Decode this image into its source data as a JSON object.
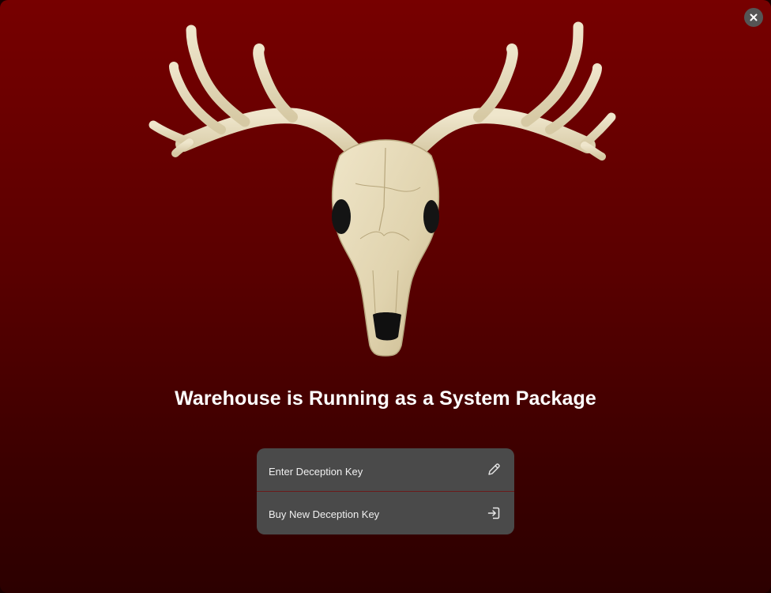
{
  "window": {
    "close_icon": "close-icon"
  },
  "hero": {
    "image": "deer-skull-antlers"
  },
  "title": "Warehouse is Running as a System Package",
  "menu": {
    "items": [
      {
        "label": "Enter Deception Key",
        "icon": "pencil-icon"
      },
      {
        "label": "Buy New Deception Key",
        "icon": "sign-in-icon"
      }
    ]
  },
  "colors": {
    "background_top": "#770000",
    "background_bottom": "#2c0000",
    "menu_bg": "#4a4a4a",
    "close_bg": "#555555"
  }
}
